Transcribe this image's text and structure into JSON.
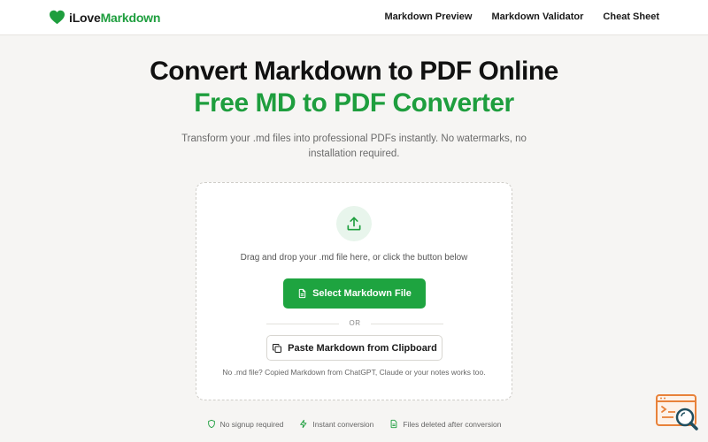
{
  "header": {
    "logo_part1": "iLove",
    "logo_part2": "Markdown",
    "nav": [
      {
        "label": "Markdown Preview"
      },
      {
        "label": "Markdown Validator"
      },
      {
        "label": "Cheat Sheet"
      }
    ]
  },
  "hero": {
    "title": "Convert Markdown to PDF Online",
    "title_accent": "Free MD to PDF Converter",
    "subtitle": "Transform your .md files into professional PDFs instantly. No watermarks, no installation required."
  },
  "upload": {
    "drop_text": "Drag and drop your .md file here, or click the button below",
    "select_button": "Select Markdown File",
    "or_label": "OR",
    "paste_button": "Paste Markdown from Clipboard",
    "note": "No .md file? Copied Markdown from ChatGPT, Claude or your notes works too."
  },
  "features": [
    {
      "label": "No signup required",
      "icon": "shield-icon"
    },
    {
      "label": "Instant conversion",
      "icon": "lightning-icon"
    },
    {
      "label": "Files deleted after conversion",
      "icon": "document-icon"
    }
  ],
  "colors": {
    "brand_green": "#1e9e3e",
    "button_green": "#1ea440",
    "background": "#f6f5f3",
    "widget_orange": "#e8823a"
  }
}
